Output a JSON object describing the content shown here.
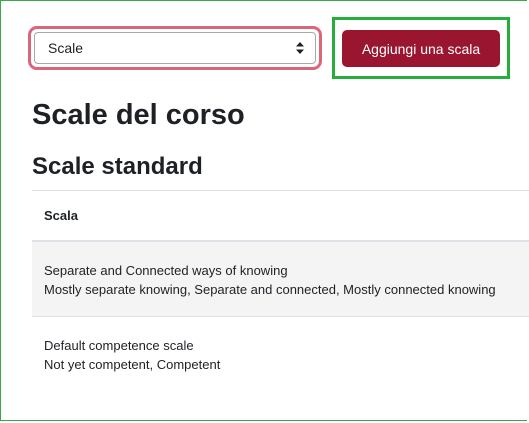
{
  "scale_select": {
    "value": "Scale"
  },
  "toolbar": {
    "add_scale_label": "Aggiungi una scala"
  },
  "page": {
    "title": "Scale del corso",
    "section_title": "Scale standard"
  },
  "table": {
    "header": "Scala",
    "rows": [
      {
        "name": "Separate and Connected ways of knowing",
        "items": "Mostly separate knowing, Separate and connected, Mostly connected knowing"
      },
      {
        "name": "Default competence scale",
        "items": "Not yet competent, Competent"
      }
    ]
  },
  "colors": {
    "primary_button": "#9a1530",
    "select_focus_border": "#d9677b",
    "highlight_border": "#26ad3b",
    "frame_border": "#3aa84a",
    "striped_row": "#f4f4f4"
  }
}
